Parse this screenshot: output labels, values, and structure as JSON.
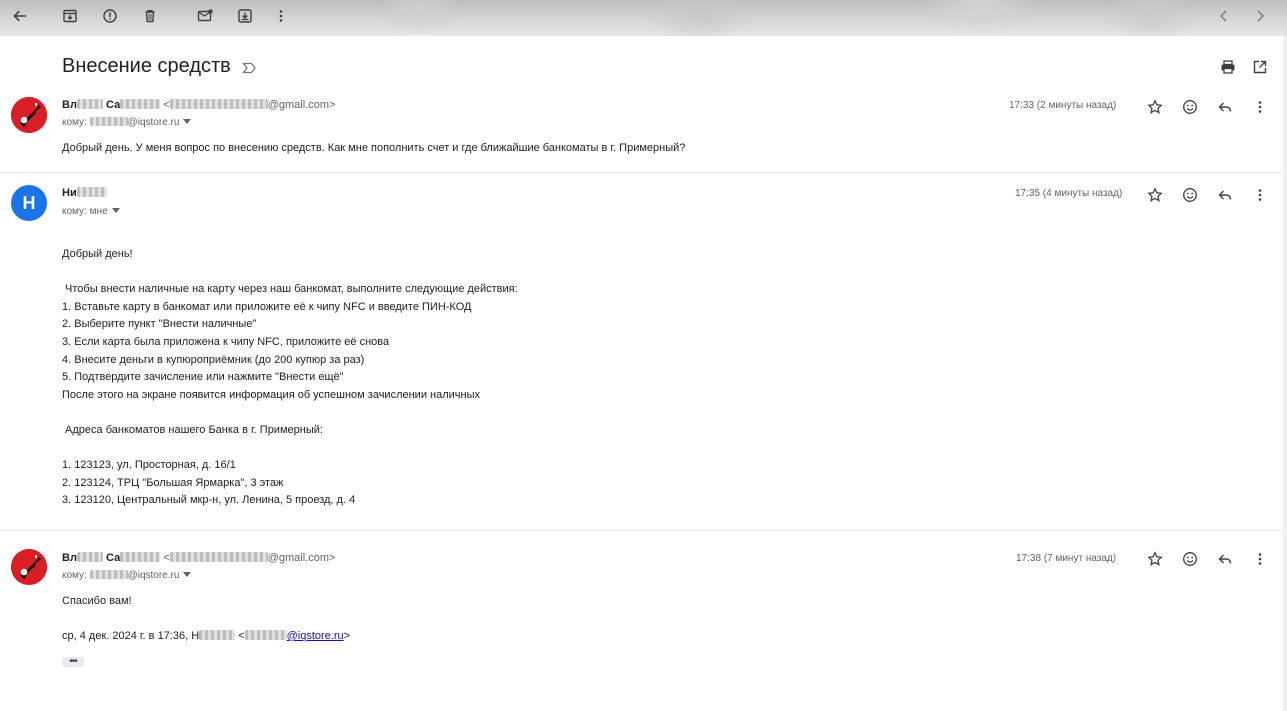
{
  "toolbar": {
    "icons": [
      "back-arrow-icon",
      "archive-icon",
      "report-spam-icon",
      "delete-icon",
      "mark-unread-icon",
      "move-to-icon",
      "more-vert-icon"
    ],
    "nav": [
      "prev-chevron-icon",
      "next-chevron-icon"
    ]
  },
  "subject": {
    "title": "Внесение средств"
  },
  "messages": [
    {
      "sender_name_start": "Вл",
      "sender_name_mid": " Са",
      "email_open": " <",
      "email_domain": "@gmail.com>",
      "to_label": "кому: ",
      "to_domain": "@iqstore.ru",
      "time": "17:33 (2 минуты назад)",
      "body": "Добрый день. У меня вопрос по внесению средств. Как мне пополнить счет и где ближайшие банкоматы в г. Примерный?"
    },
    {
      "avatar_letter": "Н",
      "sender_name_start": "Ни",
      "to_label": "кому: мне",
      "time": "17:35 (4 минуты назад)",
      "body": "Добрый день!\n\n Чтобы внести наличные на карту через наш банкомат, выполните следующие действия:\n1. Вставьте карту в банкомат или приложите её к чипу NFC и введите ПИН-КОД\n2. Выберите пункт \"Внести наличные\"\n3. Если карта была приложена к чипу NFC, приложите её снова\n4. Внесите деньги в купюроприёмник (до 200 купюр за раз)\n5. Подтвердите зачисление или нажмите \"Внести ещё\"\nПосле этого на экране появится информация об успешном зачислении наличных\n\n Адреса банкоматов нашего Банка в г. Примерный:\n\n1. 123123, ул. Просторная, д. 16/1\n2. 123124, ТРЦ \"Большая Ярмарка\", 3 этаж\n3. 123120, Центральный мкр-н, ул. Ленина, 5 проезд, д. 4"
    },
    {
      "sender_name_start": "Вл",
      "sender_name_mid": " Са",
      "email_open": " <",
      "email_domain": "@gmail.com>",
      "to_label": "кому: ",
      "to_domain": "@iqstore.ru",
      "time": "17:38 (7 минут назад)",
      "body": "Спасибо вам!",
      "quote_prefix": "ср, 4 дек. 2024 г. в 17:36, Н",
      "quote_open": " <",
      "quote_link": "@iqstore.ru",
      "quote_close": ">",
      "show_trimmed": "•••"
    }
  ]
}
